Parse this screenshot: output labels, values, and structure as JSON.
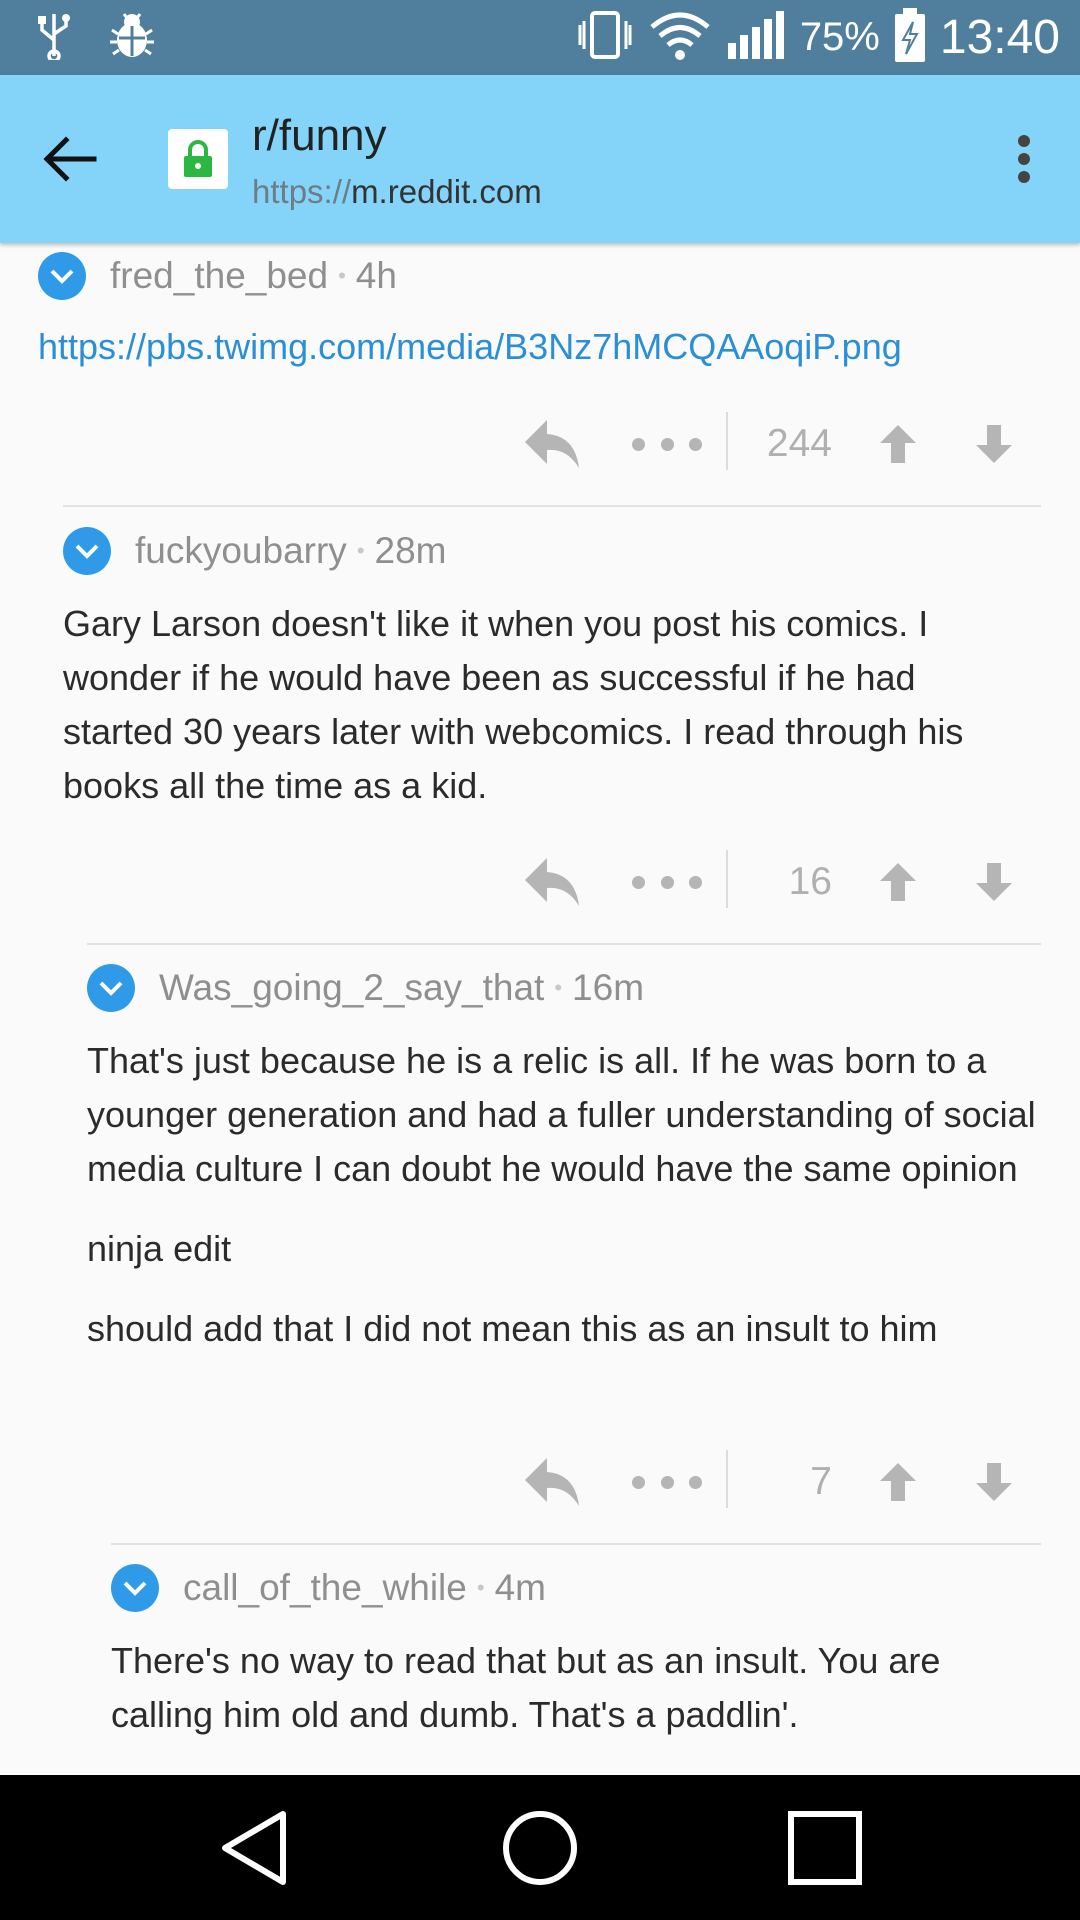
{
  "status_bar": {
    "battery": "75%",
    "time": "13:40",
    "icons": [
      "usb-icon",
      "bug-icon",
      "vibrate-icon",
      "wifi-icon",
      "signal-icon",
      "battery-charging-icon"
    ]
  },
  "toolbar": {
    "title": "r/funny",
    "url_scheme": "https://",
    "url_host": "m.reddit.com"
  },
  "comments": [
    {
      "author": "fred_the_bed",
      "age": "4h",
      "link": "https://pbs.twimg.com/media/B3Nz7hMCQAAoqiP.png",
      "score": "244"
    },
    {
      "author": "fuckyoubarry",
      "age": "28m",
      "body": "Gary Larson doesn't like it when you post his comics. I wonder if he would have been as successful if he had started 30 years later with webcomics. I read through his books all the time as a kid.",
      "score": "16"
    },
    {
      "author": "Was_going_2_say_that",
      "age": "16m",
      "body": "That's just because he is a relic is all. If he was born to a younger generation and had a fuller understanding of social media culture I can doubt he would have the same opinion",
      "para2": "ninja edit",
      "para3": "should add that I did not mean this as an insult to him",
      "score": "7"
    },
    {
      "author": "call_of_the_while",
      "age": "4m",
      "body": "There's no way to read that but as an insult. You are calling him old and dumb. That's a paddlin'."
    }
  ],
  "colors": {
    "status_bar": "#4f7f9c",
    "toolbar": "#84d4fa",
    "accent_link": "#2a8fd6",
    "collapse_badge": "#2f9be8",
    "lock_green": "#2db742"
  }
}
